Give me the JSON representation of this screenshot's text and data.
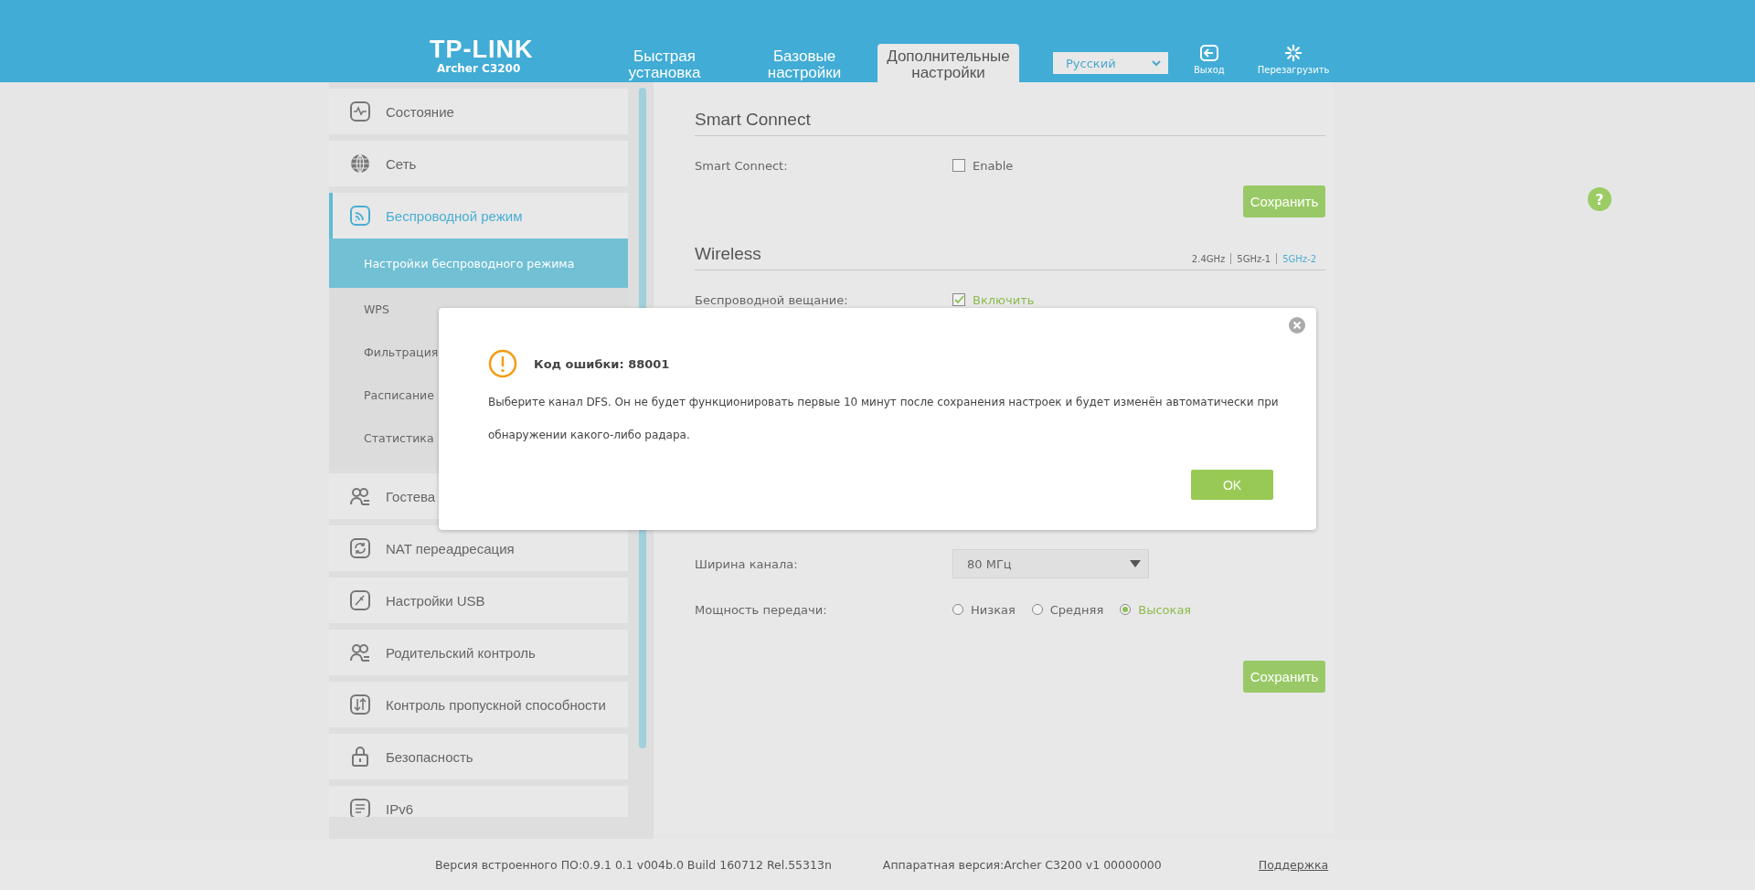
{
  "header": {
    "logo": "TP-LINK",
    "model": "Archer C3200",
    "tabs": [
      {
        "label": "Быстрая установка",
        "selected": false
      },
      {
        "label": "Базовые настройки",
        "selected": false
      },
      {
        "label": "Дополнительные настройки",
        "selected": true
      }
    ],
    "language": "Русский",
    "actions": [
      {
        "kind": "logout",
        "label": "Выход"
      },
      {
        "kind": "reboot",
        "label": "Перезагрузить"
      }
    ]
  },
  "sidebar": {
    "items": [
      {
        "label": "Состояние",
        "selected": false
      },
      {
        "label": "Сеть",
        "selected": false
      },
      {
        "label": "Беспроводной режим",
        "selected": true,
        "children": [
          {
            "label": "Настройки беспроводного режима",
            "selected": true
          },
          {
            "label": "WPS",
            "selected": false
          },
          {
            "label": "Фильтрация",
            "selected": false
          },
          {
            "label": "Расписание",
            "selected": false
          },
          {
            "label": "Статистика",
            "selected": false
          }
        ]
      },
      {
        "label": "Гостева",
        "selected": false
      },
      {
        "label": "NAT переадресация",
        "selected": false
      },
      {
        "label": "Настройки USB",
        "selected": false
      },
      {
        "label": "Родительский контроль",
        "selected": false
      },
      {
        "label": "Контроль пропускной способности",
        "selected": false
      },
      {
        "label": "Безопасность",
        "selected": false
      },
      {
        "label": "IPv6",
        "selected": false
      }
    ]
  },
  "smart_connect": {
    "title": "Smart Connect",
    "label": "Smart Connect:",
    "option": "Enable",
    "checked": false,
    "save": "Сохранить"
  },
  "wireless": {
    "title": "Wireless",
    "bands": [
      {
        "label": "2.4GHz",
        "selected": false
      },
      {
        "label": "5GHz-1",
        "selected": false
      },
      {
        "label": "5GHz-2",
        "selected": true
      }
    ],
    "broadcast": {
      "label": "Беспроводной вещание:",
      "option": "Включить",
      "checked": true
    },
    "width": {
      "label": "Ширина канала:",
      "value": "80 МГц"
    },
    "power": {
      "label": "Мощность передачи:",
      "options": [
        {
          "label": "Низкая",
          "selected": false
        },
        {
          "label": "Средняя",
          "selected": false
        },
        {
          "label": "Высокая",
          "selected": true
        }
      ]
    },
    "save": "Сохранить"
  },
  "help": "?",
  "dialog": {
    "title": "Код ошибки: 88001",
    "message": "Выберите канал DFS. Он не будет функционировать первые 10 минут после сохранения настроек и будет изменён автоматически при обнаружении какого-либо радара.",
    "ok": "OK"
  },
  "footer": {
    "firmware": "Версия встроенного ПО:0.9.1 0.1 v004b.0 Build 160712 Rel.55313n",
    "hardware": "Аппаратная версия:Archer C3200 v1 00000000",
    "support": "Поддержка"
  }
}
